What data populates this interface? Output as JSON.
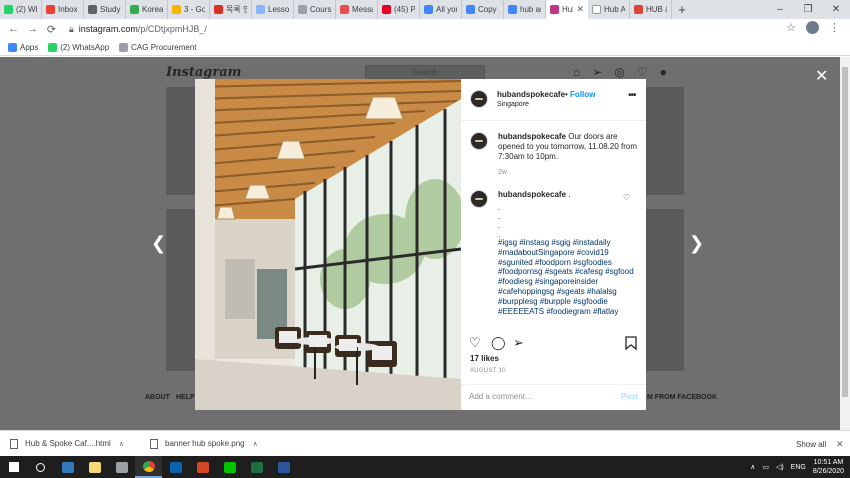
{
  "browser": {
    "tabs": [
      {
        "label": "(2) Wha",
        "color": "#25d366"
      },
      {
        "label": "Inbox -",
        "color": "#ea4335"
      },
      {
        "label": "Study T",
        "color": "#5f6368"
      },
      {
        "label": "Korean",
        "color": "#34a853"
      },
      {
        "label": "3 - Goo",
        "color": "#f4b400"
      },
      {
        "label": "목록 인",
        "color": "#d93025"
      },
      {
        "label": "Lesson",
        "color": "#8ab4f8"
      },
      {
        "label": "Course",
        "color": "#9aa0a6"
      },
      {
        "label": "Messag",
        "color": "#e94f4f"
      },
      {
        "label": "(45) Pin",
        "color": "#e60023"
      },
      {
        "label": "All you",
        "color": "#4285f4"
      },
      {
        "label": "Copy of",
        "color": "#4285f4"
      },
      {
        "label": "hub an",
        "color": "#4285f4"
      },
      {
        "label": "Hub",
        "color": "#c13584",
        "active": true
      },
      {
        "label": "Hub An",
        "color": "#ffffff"
      },
      {
        "label": "HUB &",
        "color": "#db4437"
      }
    ],
    "new_tab": "+",
    "window_controls": [
      "–",
      "❐",
      "✕"
    ],
    "url_host": "instagram.com",
    "url_path": "/p/CDtjxpmHJB_/",
    "bookmarks": [
      {
        "label": "Apps",
        "color": "#4285f4"
      },
      {
        "label": "(2) WhatsApp",
        "color": "#25d366"
      },
      {
        "label": "CAG Procurement",
        "color": "#9aa0a6"
      }
    ]
  },
  "instagram": {
    "logo": "Instagram",
    "search_placeholder": "Search",
    "footer_links": [
      "ABOUT",
      "HELP",
      "M FROM FACEBOOK"
    ],
    "post": {
      "username": "hubandspokecafe",
      "follow_sep": "•",
      "follow_label": "Follow",
      "location": "Singapore",
      "more": "•••",
      "caption_user": "hubandspokecafe",
      "caption_text": "Our doors are opened to you tomorrow, 11.08.20 from 7:30am to 10pm.",
      "caption_time": "2w",
      "comment_user": "hubandspokecafe",
      "comment_suffix": ".",
      "comment_dots": ".\n.\n.\n.",
      "hashtags": "#igsg #instasg #sgig #instadaily #madaboutSingapore #covid19 #sgunited #foodporn #sgfoodies #foodpornsg #sgeats #cafesg #sgfood #foodiesg #singaporeinsider #cafehoppingsg #sgeats #halalsg #burpplesg #burpple #sgfoodie #EEEEEATS #foodiegram #flatlay",
      "likes": "17 likes",
      "date": "AUGUST 10",
      "comment_placeholder": "Add a comment…",
      "post_button": "Post"
    }
  },
  "downloads": {
    "items": [
      {
        "name": "Hub & Spoke Caf....html"
      },
      {
        "name": "banner hub spoke.png"
      }
    ],
    "show_all": "Show all"
  },
  "taskbar": {
    "apps": [
      {
        "name": "windows-start",
        "color": "#ffffff"
      },
      {
        "name": "search",
        "color": "#ffffff"
      },
      {
        "name": "edge",
        "color": "#3277bc"
      },
      {
        "name": "file-explorer",
        "color": "#f8d775"
      },
      {
        "name": "vpn",
        "color": "#9aa0a6"
      },
      {
        "name": "chrome",
        "color": "#34a853",
        "active": true
      },
      {
        "name": "outlook",
        "color": "#0a64ad"
      },
      {
        "name": "powerpoint",
        "color": "#d24726"
      },
      {
        "name": "line",
        "color": "#00c300"
      },
      {
        "name": "excel",
        "color": "#1d6f42"
      },
      {
        "name": "word",
        "color": "#2b579a"
      }
    ],
    "language": "ENG",
    "time": "10:51 AM",
    "date": "8/26/2020"
  }
}
